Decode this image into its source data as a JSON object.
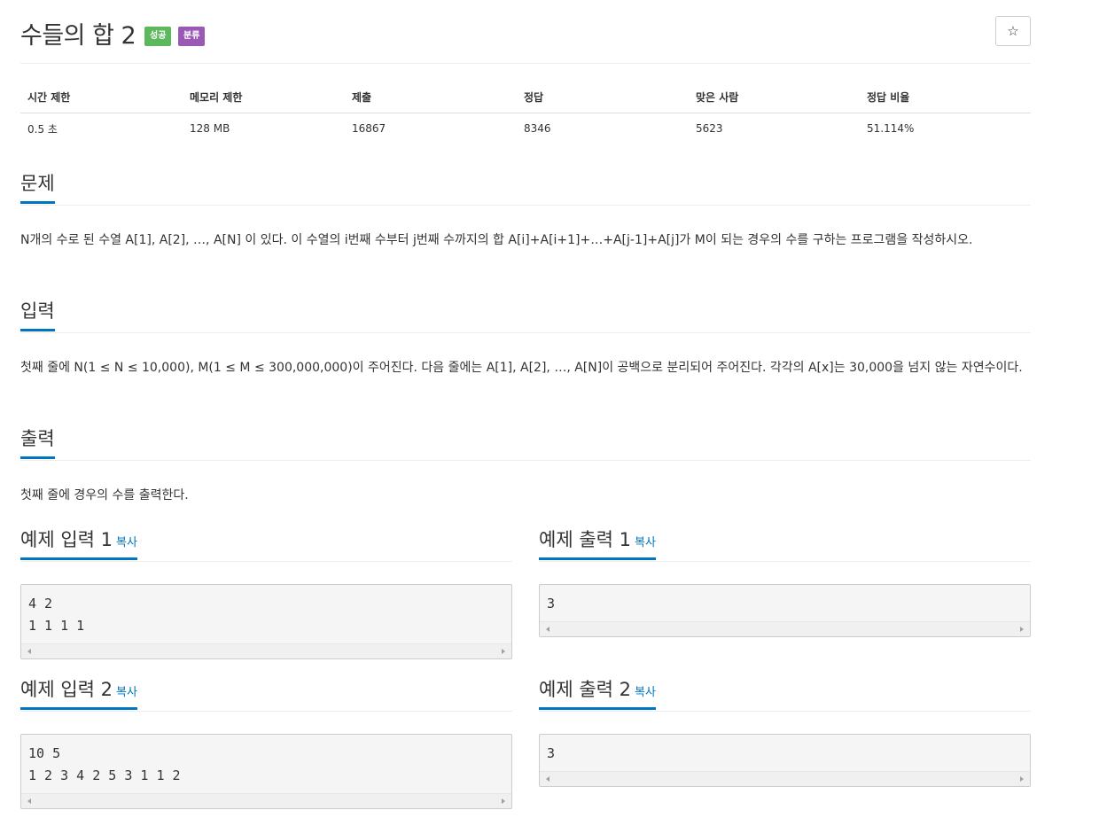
{
  "problem": {
    "title": "수들의 합 2",
    "badges": {
      "success": "성공",
      "category": "분류"
    },
    "star_icon": "☆"
  },
  "info_table": {
    "headers": [
      "시간 제한",
      "메모리 제한",
      "제출",
      "정답",
      "맞은 사람",
      "정답 비율"
    ],
    "values": [
      "0.5 초",
      "128 MB",
      "16867",
      "8346",
      "5623",
      "51.114%"
    ]
  },
  "sections": {
    "problem": {
      "title": "문제",
      "text": "N개의 수로 된 수열 A[1], A[2], …, A[N] 이 있다. 이 수열의 i번째 수부터 j번째 수까지의 합 A[i]+A[i+1]+…+A[j-1]+A[j]가 M이 되는 경우의 수를 구하는 프로그램을 작성하시오."
    },
    "input": {
      "title": "입력",
      "text": "첫째 줄에 N(1 ≤ N ≤ 10,000), M(1 ≤ M ≤ 300,000,000)이 주어진다. 다음 줄에는 A[1], A[2], …, A[N]이 공백으로 분리되어 주어진다. 각각의 A[x]는 30,000을 넘지 않는 자연수이다."
    },
    "output": {
      "title": "출력",
      "text": "첫째 줄에 경우의 수를 출력한다."
    }
  },
  "samples": {
    "copy_label": "복사",
    "input1": {
      "title": "예제 입력 1",
      "content": "4 2\n1 1 1 1"
    },
    "output1": {
      "title": "예제 출력 1",
      "content": "3"
    },
    "input2": {
      "title": "예제 입력 2",
      "content": "10 5\n1 2 3 4 2 5 3 1 1 2"
    },
    "output2": {
      "title": "예제 출력 2",
      "content": "3"
    }
  },
  "colors": {
    "accent": "#0076c0",
    "success": "#5cb85c",
    "category": "#9b59b6"
  }
}
